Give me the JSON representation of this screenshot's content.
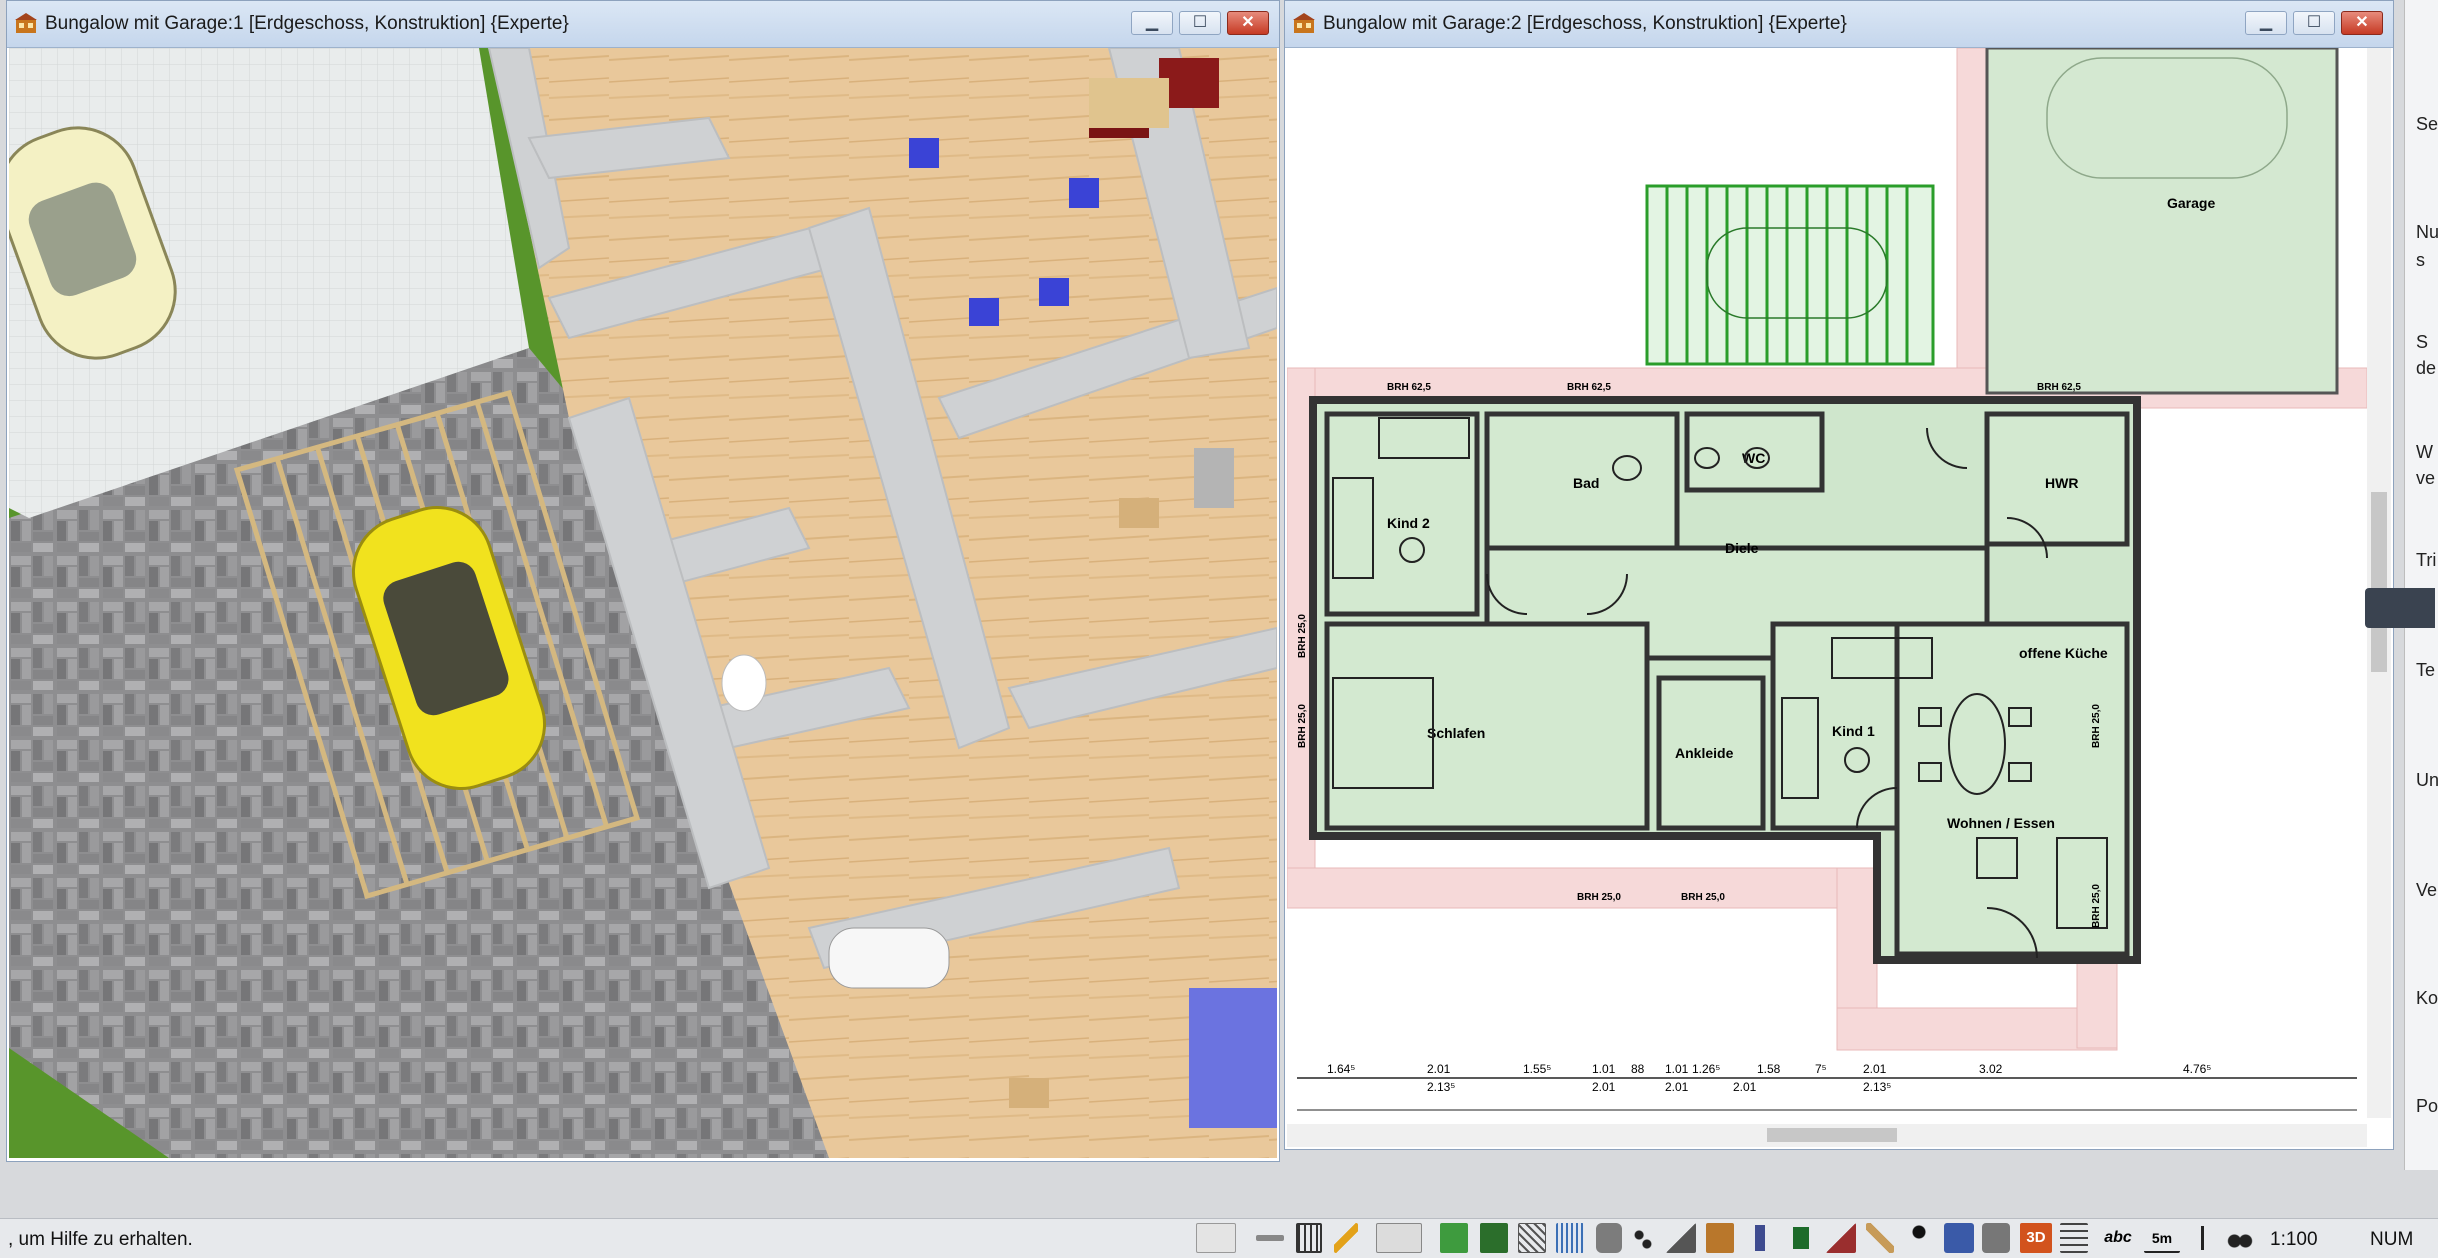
{
  "window1": {
    "title": "Bungalow mit Garage:1 [Erdgeschoss, Konstruktion] {Experte}",
    "controls": {
      "minimize": "▁",
      "maximize": "☐",
      "close": "✕"
    }
  },
  "window2": {
    "title": "Bungalow mit Garage:2 [Erdgeschoss, Konstruktion] {Experte}",
    "controls": {
      "minimize": "▁",
      "maximize": "☐",
      "close": "✕"
    },
    "rooms": {
      "garage": "Garage",
      "bad": "Bad",
      "wc": "WC",
      "hwr": "HWR",
      "kind2": "Kind 2",
      "diele": "Diele",
      "schlafen": "Schlafen",
      "ankleide": "Ankleide",
      "kind1": "Kind 1",
      "kueche": "offene Küche",
      "wohnen": "Wohnen / Essen"
    },
    "brh_labels": {
      "top1": "BRH 62,5",
      "top2": "BRH 62,5",
      "top3": "BRH 62,5",
      "left1": "BRH 25,0",
      "left2": "BRH 25,0",
      "bottom1": "BRH 25,0",
      "bottom2": "BRH 25,0",
      "right1": "BRH 25,0",
      "right2": "BRH 25,0"
    },
    "dimensions_top": [
      "1.64⁵",
      "2.01",
      "1.55⁵",
      "1.01",
      "88",
      "1.01",
      "1.26⁵",
      "1.58",
      "7⁵",
      "2.01",
      "3.02",
      "4.76⁵"
    ],
    "dimensions_bottom": [
      "2.13⁵",
      "2.01",
      "2.01",
      "2.01",
      "2.13⁵"
    ]
  },
  "right_panel": {
    "fragments": [
      "Se",
      "Nu",
      "s",
      "S",
      "de",
      "W",
      "ve",
      "Tri",
      "Te",
      "Un",
      "Ve",
      "Ko",
      "Po"
    ]
  },
  "statusbar": {
    "help_text": ", um Hilfe zu erhalten.",
    "scale": "1:100",
    "num": "NUM",
    "tool_labels": {
      "threed": "3D",
      "abc": "abc",
      "five_m": "5m"
    }
  }
}
